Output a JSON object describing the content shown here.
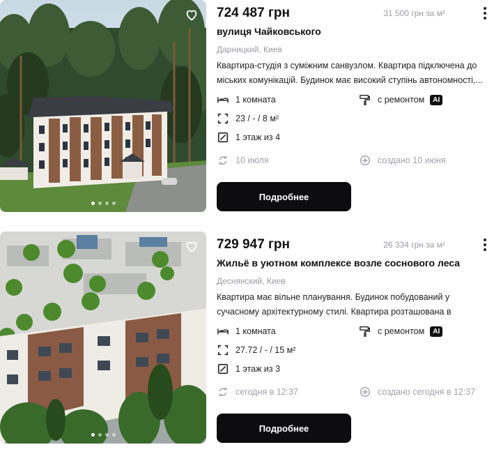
{
  "listings": [
    {
      "price": "724 487 грн",
      "price_per_m2": "31 500 грн за м²",
      "title": "вулиця Чайковського",
      "location": "Дарницкий, Киев",
      "description": "Квартира-студія з суміжним санвузлом. Квартира підключена до міських комунікацій. Будинок має високий ступінь автономності,...",
      "rooms": "1 комната",
      "area": "23 / - / 8 м²",
      "floor": "1 этаж из 4",
      "condition": "с ремонтом",
      "ai_badge": "AI",
      "updated": "10 июля",
      "created": "создано 10 июня",
      "button": "Подробнее",
      "photo_slides": 4,
      "photo_active": 1
    },
    {
      "price": "729 947 грн",
      "price_per_m2": "26 334 грн за м²",
      "title": "Жильё в уютном комплексе возле соснового леса",
      "location": "Деснянский, Киев",
      "description": "Квартира має вільне планування. Будинок побудований у сучасному архітектурному стилі. Квартира розташована в екологічно чистій...",
      "rooms": "1 комната",
      "area": "27.72 / - / 15 м²",
      "floor": "1 этаж из 3",
      "condition": "с ремонтом",
      "ai_badge": "AI",
      "updated": "сегодня в 12:37",
      "created": "создано сегодня в 12:37",
      "button": "Подробнее",
      "photo_slides": 4,
      "photo_active": 1
    }
  ],
  "icons": {
    "favorite": "heart-outline-icon",
    "more": "vertical-dots-icon",
    "rooms": "bed-icon",
    "area": "area-corners-icon",
    "floor": "stairs-icon",
    "condition": "paint-roller-icon",
    "updated": "refresh-icon",
    "created": "plus-circle-icon"
  },
  "colors": {
    "button_bg": "#0d0d0f",
    "muted_text": "#9a9aa2"
  }
}
